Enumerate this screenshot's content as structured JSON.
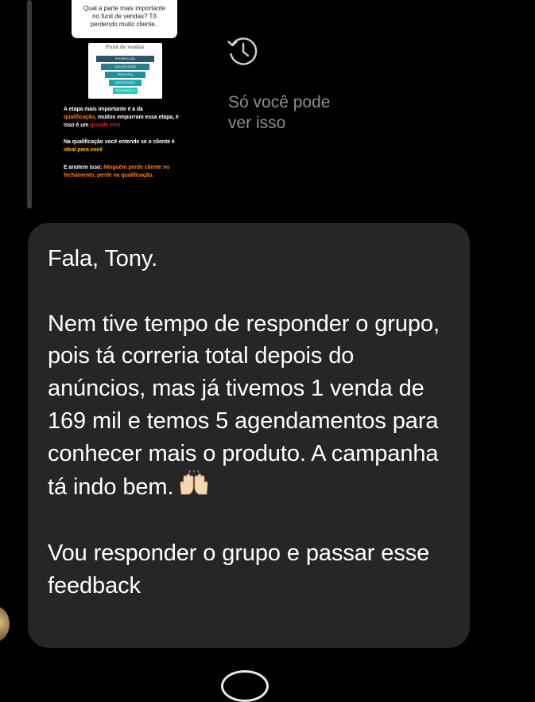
{
  "story_reply": {
    "question_text": "Qual a parte mais importante\nno funil de vendas? Tô\nperdendo muito cliente..",
    "funnel": {
      "title": "Funil de vendas",
      "levels": [
        "PROSPECÇÃO",
        "QUALIFICAÇÃO",
        "PROPOSTA",
        "NEGOCIAÇÃO",
        "FECHAMENTO"
      ],
      "colors": [
        "#2e5467",
        "#2c7d8c",
        "#1f8e9e",
        "#1ba8b5",
        "#27c7c6"
      ]
    },
    "caption_1": {
      "a": "A etapa mais importante é a da",
      "b": "qualificação,",
      "c": " muitos empurram essa etapa, é isso é um ",
      "d": "grande erro"
    },
    "caption_2": {
      "a": "Na qualificação você entende se o cliente é ",
      "b": "ideal para você"
    },
    "caption_3": {
      "a": "E anotem isso: ",
      "b": "Ninguém perde cliente no fechamento, perde na qualificação."
    }
  },
  "archive_note": {
    "icon": "history-clock-icon",
    "text": "Só você pode\nver isso"
  },
  "message": {
    "greeting": "Fala, Tony.",
    "body": "Nem tive tempo de responder o grupo, pois tá correria total depois do anúncios, mas já tivemos 1 venda de 169 mil e temos 5 agendamentos para conhecer mais o produto. A campanha tá indo bem.",
    "emoji": "raising-hands-icon",
    "closing": "Vou responder o grupo e passar esse feedback"
  },
  "colors": {
    "background": "#000000",
    "bubble": "#262626",
    "muted_text": "#8e8e93",
    "accent_orange": "#ff7b18",
    "accent_red": "#e11f1f",
    "accent_yellow": "#ffb400"
  }
}
